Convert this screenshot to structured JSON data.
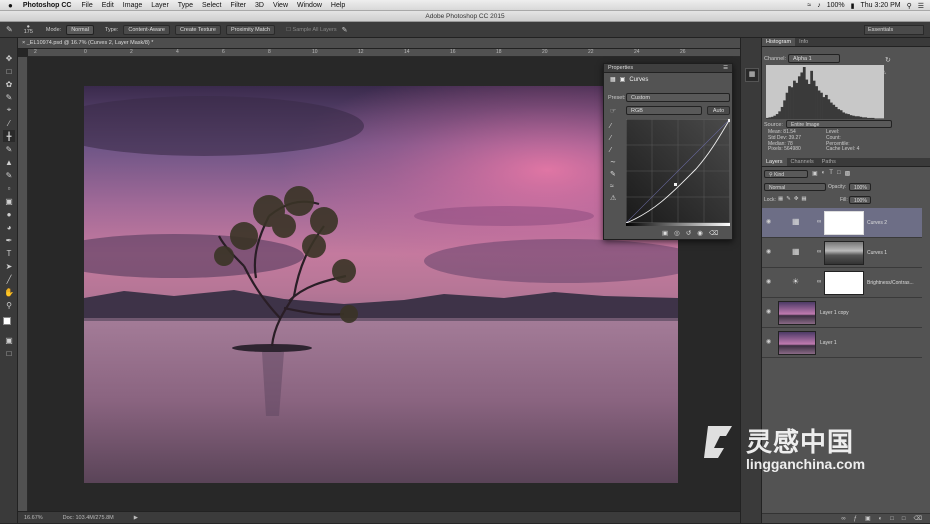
{
  "menubar": {
    "apple": "",
    "app": "Photoshop CC",
    "items": [
      "File",
      "Edit",
      "Image",
      "Layer",
      "Type",
      "Select",
      "Filter",
      "3D",
      "View",
      "Window",
      "Help"
    ],
    "battery": "100%",
    "clock": "Thu 3:20 PM"
  },
  "window_title": "Adobe Photoshop CC 2015",
  "options": {
    "brush_size": "175",
    "mode_label": "Mode:",
    "mode_value": "Normal",
    "type_label": "Type:",
    "type_content_aware": "Content-Aware",
    "type_create_texture": "Create Texture",
    "type_proximity": "Proximity Match",
    "sample_all": "Sample All Layers",
    "workspace": "Essentials"
  },
  "document": {
    "tab": "_EL10974.psd @ 16.7% (Curves 2, Layer Mask/8) *",
    "ruler_ticks": [
      "2",
      "0",
      "2",
      "4",
      "6",
      "8",
      "10",
      "12",
      "14",
      "16",
      "18",
      "20",
      "22",
      "24",
      "26"
    ],
    "zoom": "16.67%",
    "doc_size": "Doc: 103.4M/275.8M"
  },
  "properties": {
    "tab": "Properties",
    "title": "Curves",
    "preset_label": "Preset:",
    "preset_value": "Custom",
    "channel": "RGB",
    "auto": "Auto"
  },
  "histogram": {
    "tabs": [
      "Histogram",
      "Info"
    ],
    "channel_label": "Channel:",
    "channel_value": "Alpha 1",
    "source_label": "Source:",
    "source_value": "Entire Image",
    "stats_left": [
      [
        "Mean:",
        "81.54"
      ],
      [
        "Std Dev:",
        "39.27"
      ],
      [
        "Median:",
        "78"
      ],
      [
        "Pixels:",
        "564980"
      ]
    ],
    "stats_right": [
      [
        "Level:",
        ""
      ],
      [
        "Count:",
        ""
      ],
      [
        "Percentile:",
        ""
      ],
      [
        "Cache Level:",
        "4"
      ]
    ],
    "bins": [
      2,
      3,
      4,
      6,
      9,
      14,
      22,
      34,
      48,
      60,
      58,
      70,
      66,
      78,
      85,
      95,
      72,
      64,
      88,
      70,
      60,
      52,
      48,
      40,
      44,
      36,
      30,
      26,
      22,
      18,
      16,
      12,
      10,
      9,
      7,
      6,
      5,
      5,
      4,
      3,
      3,
      2,
      2,
      2,
      1,
      1,
      1,
      1
    ]
  },
  "layers": {
    "tabs": [
      "Layers",
      "Channels",
      "Paths"
    ],
    "kind": "Kind",
    "blend": "Normal",
    "opacity_label": "Opacity:",
    "opacity": "100%",
    "lock_label": "Lock:",
    "fill_label": "Fill:",
    "fill": "100%",
    "items": [
      {
        "name": "Curves 2"
      },
      {
        "name": "Curves 1"
      },
      {
        "name": "Brightness/Contras..."
      },
      {
        "name": "Layer 1 copy"
      },
      {
        "name": "Layer 1"
      }
    ]
  },
  "watermark": {
    "cn": "灵感中国",
    "url": "lingganchina.com"
  },
  "colors": {
    "accent_selected": "#6d6e86",
    "panel": "#535353"
  }
}
